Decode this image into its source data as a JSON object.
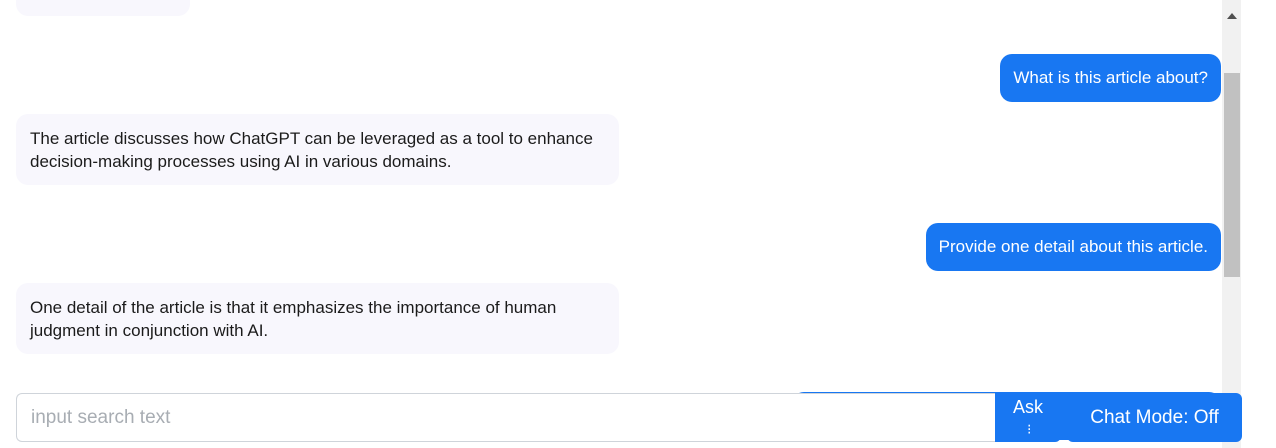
{
  "messages": [
    {
      "role": "user",
      "text": "What is this article about?"
    },
    {
      "role": "bot",
      "text": "The article discusses how ChatGPT can be leveraged as a tool to enhance decision-making processes using AI in various domains."
    },
    {
      "role": "user",
      "text": "Provide one detail about this article."
    },
    {
      "role": "bot",
      "text": "One detail of the article is that it emphasizes the importance of human judgment in conjunction with AI."
    }
  ],
  "input": {
    "value": "",
    "placeholder": "input search text"
  },
  "buttons": {
    "ask_label": "Ask",
    "chat_mode_label": "Chat Mode: Off"
  },
  "colors": {
    "accent": "#1877f2",
    "bot_bubble": "#f8f7fd"
  }
}
